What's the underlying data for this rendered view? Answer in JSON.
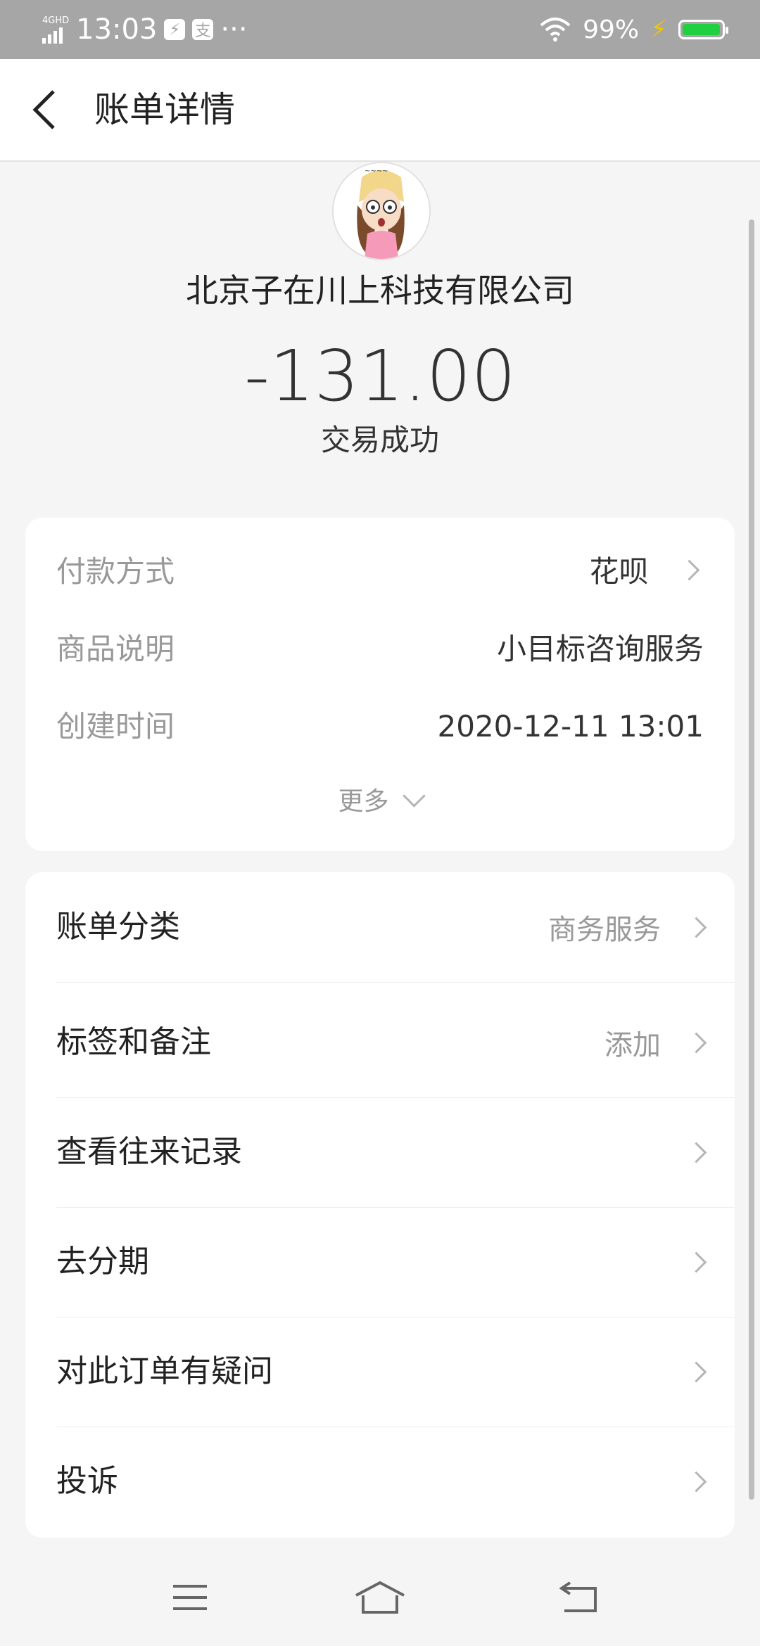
{
  "status_bar": {
    "network": "4GHD",
    "time": "13:03",
    "battery_percent": "99%",
    "battery_level": 0.99
  },
  "header": {
    "title": "账单详情"
  },
  "transaction": {
    "merchant": "北京子在川上科技有限公司",
    "amount": "-131.00",
    "status": "交易成功"
  },
  "details": {
    "payment_method": {
      "label": "付款方式",
      "value": "花呗"
    },
    "product_desc": {
      "label": "商品说明",
      "value": "小目标咨询服务"
    },
    "created_time": {
      "label": "创建时间",
      "value": "2020-12-11 13:01"
    },
    "more_label": "更多"
  },
  "actions": [
    {
      "label": "账单分类",
      "value": "商务服务"
    },
    {
      "label": "标签和备注",
      "value": "添加"
    },
    {
      "label": "查看往来记录",
      "value": ""
    },
    {
      "label": "去分期",
      "value": ""
    },
    {
      "label": "对此订单有疑问",
      "value": ""
    },
    {
      "label": "投诉",
      "value": ""
    }
  ],
  "colors": {
    "status_bar_bg": "#a6a6a6",
    "battery_green": "#20d040",
    "page_bg": "#f5f5f5"
  }
}
